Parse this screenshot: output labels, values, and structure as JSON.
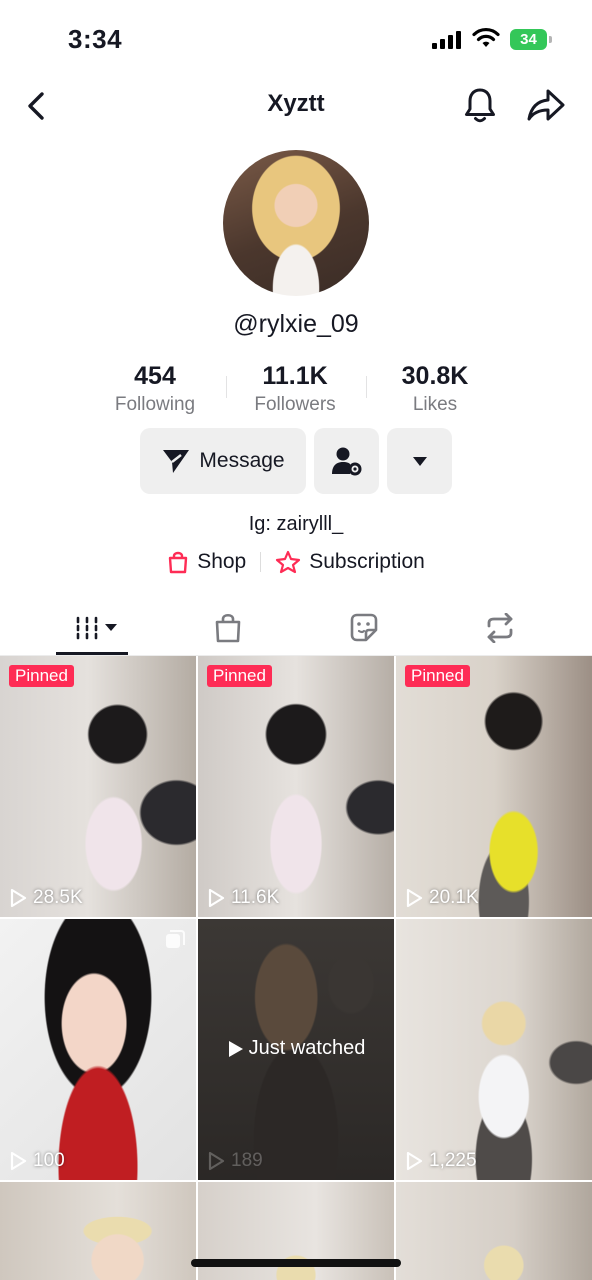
{
  "status_bar": {
    "time": "3:34",
    "battery": "34"
  },
  "header": {
    "title": "Xyztt",
    "back_icon": "chevron-left-icon",
    "bell_icon": "bell-icon",
    "share_icon": "share-arrow-icon"
  },
  "profile": {
    "username": "@rylxie_09",
    "stats": [
      {
        "value": "454",
        "label": "Following"
      },
      {
        "value": "11.1K",
        "label": "Followers"
      },
      {
        "value": "30.8K",
        "label": "Likes"
      }
    ],
    "message_label": "Message",
    "bio": "Ig: zairylll_",
    "shop_label": "Shop",
    "subscription_label": "Subscription"
  },
  "tabs": [
    "videos-grid-icon",
    "shopping-bag-icon",
    "sticker-icon",
    "repost-icon"
  ],
  "videos": [
    {
      "pinned": "Pinned",
      "views": "28.5K"
    },
    {
      "pinned": "Pinned",
      "views": "11.6K"
    },
    {
      "pinned": "Pinned",
      "views": "20.1K"
    },
    {
      "pinned": "",
      "views": "100"
    },
    {
      "pinned": "",
      "views": "189",
      "overlay": "Just watched"
    },
    {
      "pinned": "",
      "views": "1,225"
    }
  ],
  "colors": {
    "accent": "#fe2c55",
    "button_bg": "#efefef",
    "text": "#161823",
    "muted": "#7a7b80"
  }
}
